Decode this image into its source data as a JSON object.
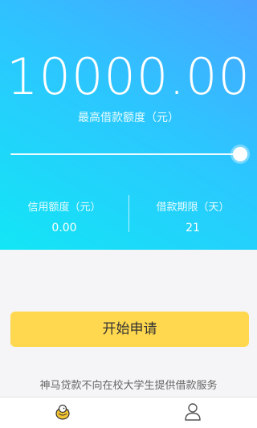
{
  "loan": {
    "amount": "10000.00",
    "amount_label": "最高借款额度（元）",
    "slider_fraction": 1.0
  },
  "stats": {
    "credit_label": "信用额度（元）",
    "credit_value": "0.00",
    "term_label": "借款期限（天）",
    "term_value": "21"
  },
  "actions": {
    "apply_label": "开始申请"
  },
  "notice": "神马贷款不向在校大学生提供借款服务",
  "tabs": [
    {
      "icon": "bird-icon"
    },
    {
      "icon": "user-icon"
    }
  ],
  "colors": {
    "accent_yellow": "#ffd84f",
    "gradient_top": "#4aa3ff",
    "gradient_bottom": "#12e6f5"
  }
}
